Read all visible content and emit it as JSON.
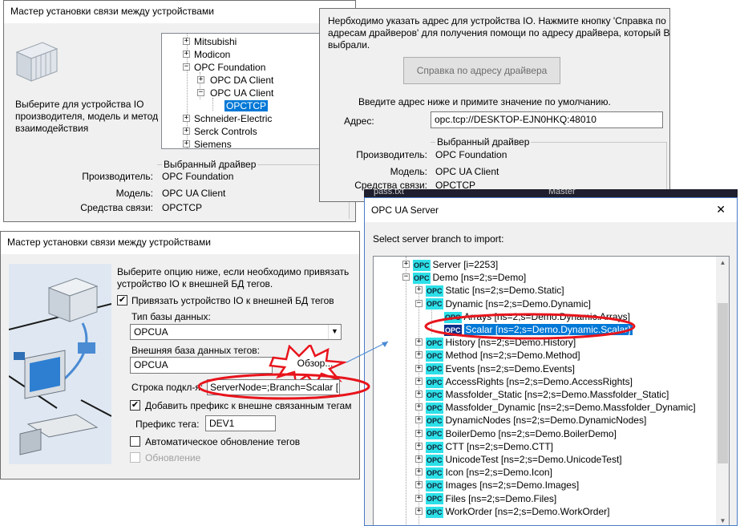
{
  "wizard_top": {
    "title": "Мастер установки связи между устройствами",
    "instruction": "Выберите для устройства IO производителя, модель и метод взаимодействия",
    "tree": [
      {
        "label": "Mitsubishi",
        "expander": "+"
      },
      {
        "label": "Modicon",
        "expander": "+"
      },
      {
        "label": "OPC Foundation",
        "expander": "−"
      },
      {
        "label": "OPC DA Client",
        "expander": "+"
      },
      {
        "label": "OPC UA Client",
        "expander": "−"
      },
      {
        "label": "OPCTCP",
        "expander": ""
      },
      {
        "label": "Schneider-Electric",
        "expander": "+"
      },
      {
        "label": "Serck Controls",
        "expander": "+"
      },
      {
        "label": "Siemens",
        "expander": "+"
      }
    ],
    "selected_driver": {
      "group_title": "Выбранный драйвер",
      "manufacturer_label": "Производитель:",
      "manufacturer_value": "OPC Foundation",
      "model_label": "Модель:",
      "model_value": "OPC UA Client",
      "comm_label": "Средства связи:",
      "comm_value": "OPCTCP"
    }
  },
  "address_dialog": {
    "info_text_1": "Нербходимо указать адрес для устройства IO. Нажмите кнопку 'Справка по",
    "info_text_2": "адресам драйверов' для получения помощи по адресу драйвера, который Вы",
    "info_text_3": "выбрали.",
    "help_button": "Справка по адресу драйвера",
    "enter_address_text": "Введите адрес ниже и примите значение по умолчанию.",
    "address_label": "Адрес:",
    "address_value": "opc.tcp://DESKTOP-EJN0HKQ:48010",
    "selected_driver": {
      "group_title": "Выбранный драйвер",
      "manufacturer_label": "Производитель:",
      "manufacturer_value": "OPC Foundation",
      "model_label": "Модель:",
      "model_value": "OPC UA Client",
      "comm_label": "Средства связи:",
      "comm_value": "OPCTCP"
    }
  },
  "background_fragments": {
    "file_tab": "pass.txt",
    "master_tab": "Master"
  },
  "wizard_bottom": {
    "title": "Мастер установки связи между устройствами",
    "instruction_1": "Выберите опцию ниже, если необходимо привязать",
    "instruction_2": "устройство IO к внешней БД тегов.",
    "bind_checkbox_label": "Привязать устройство IO к внешней БД тегов",
    "bind_checked": "✔",
    "db_type_label": "Тип базы данных:",
    "db_type_value": "OPCUA",
    "ext_db_label": "Внешняя база данных тегов:",
    "ext_db_value": "OPCUA",
    "browse_button": "Обзор...",
    "conn_string_label": "Строка подкл-я:",
    "conn_string_value": "ServerNode=;Branch=Scalar [ns",
    "prefix_checkbox_label": "Добавить префикс к внешне связанным тегам",
    "prefix_checked": "✔",
    "tag_prefix_label": "Префикс тега:",
    "tag_prefix_value": "DEV1",
    "auto_update_label": "Автоматическое обновление тегов",
    "update_label": "Обновление"
  },
  "opc_server": {
    "title": "OPC UA Server",
    "close": "✕",
    "select_branch_label": "Select server branch to import:",
    "opc_badge": "OPC",
    "nodes": [
      {
        "label": "Server [i=2253]",
        "expander": "+"
      },
      {
        "label": "Demo [ns=2;s=Demo]",
        "expander": "−"
      },
      {
        "label": "Static [ns=2;s=Demo.Static]",
        "expander": "+"
      },
      {
        "label": "Dynamic [ns=2;s=Demo.Dynamic]",
        "expander": "−"
      },
      {
        "label": "Arrays [ns=2;s=Demo.Dynamic.Arrays]",
        "expander": ""
      },
      {
        "label": "Scalar [ns=2;s=Demo.Dynamic.Scalar]",
        "expander": ""
      },
      {
        "label": "History [ns=2;s=Demo.History]",
        "expander": "+"
      },
      {
        "label": "Method [ns=2;s=Demo.Method]",
        "expander": "+"
      },
      {
        "label": "Events [ns=2;s=Demo.Events]",
        "expander": "+"
      },
      {
        "label": "AccessRights [ns=2;s=Demo.AccessRights]",
        "expander": "+"
      },
      {
        "label": "Massfolder_Static [ns=2;s=Demo.Massfolder_Static]",
        "expander": "+"
      },
      {
        "label": "Massfolder_Dynamic [ns=2;s=Demo.Massfolder_Dynamic]",
        "expander": "+"
      },
      {
        "label": "DynamicNodes [ns=2;s=Demo.DynamicNodes]",
        "expander": "+"
      },
      {
        "label": "BoilerDemo [ns=2;s=Demo.BoilerDemo]",
        "expander": "+"
      },
      {
        "label": "CTT [ns=2;s=Demo.CTT]",
        "expander": "+"
      },
      {
        "label": "UnicodeTest [ns=2;s=Demo.UnicodeTest]",
        "expander": "+"
      },
      {
        "label": "Icon [ns=2;s=Demo.Icon]",
        "expander": "+"
      },
      {
        "label": "Images [ns=2;s=Demo.Images]",
        "expander": "+"
      },
      {
        "label": "Files [ns=2;s=Demo.Files]",
        "expander": "+"
      },
      {
        "label": "WorkOrder [ns=2;s=Demo.WorkOrder]",
        "expander": "+"
      }
    ]
  },
  "colors": {
    "highlight_red": "#e8141c",
    "selection_blue": "#0078d7",
    "opc_cyan": "#2de0e8",
    "arrow_blue": "#4a8bd4"
  }
}
